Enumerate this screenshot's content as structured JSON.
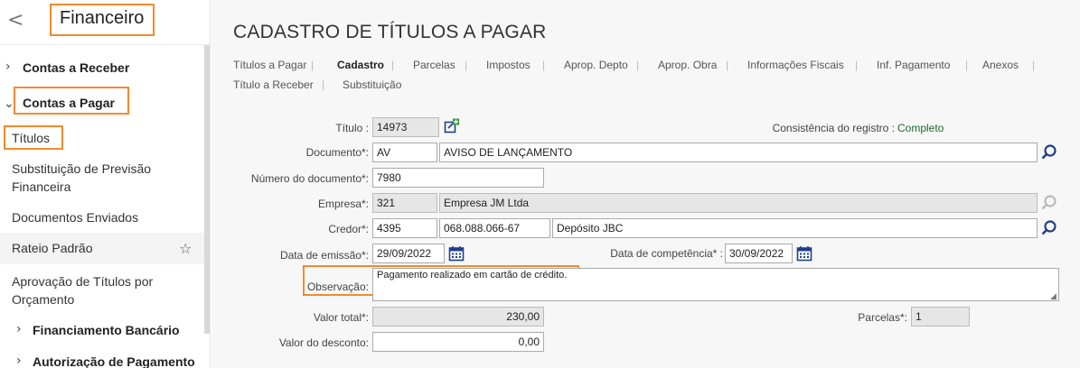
{
  "sidebar": {
    "back_label": "<",
    "title": "Financeiro",
    "items": [
      {
        "label": "Contas a Receber"
      },
      {
        "label": "Contas a Pagar"
      },
      {
        "label": "Títulos"
      },
      {
        "label": "Substituição de Previsão Financeira"
      },
      {
        "label": "Documentos Enviados"
      },
      {
        "label": "Rateio Padrão"
      },
      {
        "label": "Aprovação de Títulos por Orçamento"
      },
      {
        "label": "Financiamento Bancário"
      },
      {
        "label": "Autorização de Pagamento"
      }
    ]
  },
  "main": {
    "title": "CADASTRO DE TÍTULOS A PAGAR",
    "tabs": [
      {
        "label": "Títulos a Pagar"
      },
      {
        "label": "Cadastro"
      },
      {
        "label": "Parcelas"
      },
      {
        "label": "Impostos"
      },
      {
        "label": "Aprop. Depto"
      },
      {
        "label": "Aprop. Obra"
      },
      {
        "label": "Informações Fiscais"
      },
      {
        "label": "Inf. Pagamento"
      },
      {
        "label": "Anexos"
      },
      {
        "label": "Título a Receber"
      },
      {
        "label": "Substituição"
      }
    ],
    "form": {
      "titulo_label": "Título :",
      "titulo_value": "14973",
      "consistencia_label": "Consistência do registro :",
      "consistencia_value": "Completo",
      "documento_label": "Documento*:",
      "documento_code": "AV",
      "documento_desc": "AVISO DE LANÇAMENTO",
      "numero_label": "Número do documento*:",
      "numero_value": "7980",
      "empresa_label": "Empresa*:",
      "empresa_code": "321",
      "empresa_name": "Empresa JM Ltda",
      "credor_label": "Credor*:",
      "credor_code": "4395",
      "credor_doc": "068.088.066-67",
      "credor_name": "Depósito JBC",
      "emissao_label": "Data de emissão*:",
      "emissao_value": "29/09/2022",
      "competencia_label": "Data de competência* :",
      "competencia_value": "30/09/2022",
      "observacao_label": "Observação:",
      "observacao_value": "Pagamento realizado em cartão de crédito.",
      "valor_total_label": "Valor total*:",
      "valor_total_value": "230,00",
      "parcelas_label": "Parcelas*:",
      "parcelas_value": "1",
      "desconto_label": "Valor do desconto:",
      "desconto_value": "0,00"
    }
  },
  "colors": {
    "highlight": "#f28a2e",
    "status_ok": "#1a6a2a",
    "icon_blue": "#1f3f8a"
  }
}
